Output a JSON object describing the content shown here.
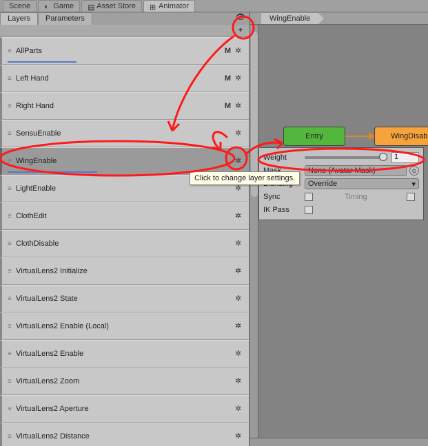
{
  "topTabs": [
    "Scene",
    "Game",
    "Asset Store",
    "Animator"
  ],
  "activeTopTab": "Animator",
  "subTabs": {
    "layers": "Layers",
    "parameters": "Parameters"
  },
  "breadcrumb": "WingEnable",
  "layers": [
    {
      "name": "AllParts",
      "m": true,
      "selected": false,
      "wbar": 100
    },
    {
      "name": "Left Hand",
      "m": true,
      "selected": false,
      "wbar": 0
    },
    {
      "name": "Right Hand",
      "m": true,
      "selected": false,
      "wbar": 0
    },
    {
      "name": "SensuEnable",
      "m": false,
      "selected": false,
      "wbar": 0
    },
    {
      "name": "WingEnable",
      "m": false,
      "selected": true,
      "wbar": 130
    },
    {
      "name": "LightEnable",
      "m": false,
      "selected": false,
      "wbar": 0
    },
    {
      "name": "ClothEdit",
      "m": false,
      "selected": false,
      "wbar": 0
    },
    {
      "name": "ClothDisable",
      "m": false,
      "selected": false,
      "wbar": 0
    },
    {
      "name": "VirtualLens2 Initialize",
      "m": false,
      "selected": false,
      "wbar": 0
    },
    {
      "name": "VirtualLens2 State",
      "m": false,
      "selected": false,
      "wbar": 0
    },
    {
      "name": "VirtualLens2 Enable (Local)",
      "m": false,
      "selected": false,
      "wbar": 0
    },
    {
      "name": "VirtualLens2 Enable",
      "m": false,
      "selected": false,
      "wbar": 0
    },
    {
      "name": "VirtualLens2 Zoom",
      "m": false,
      "selected": false,
      "wbar": 0
    },
    {
      "name": "VirtualLens2 Aperture",
      "m": false,
      "selected": false,
      "wbar": 0
    },
    {
      "name": "VirtualLens2 Distance",
      "m": false,
      "selected": false,
      "wbar": 0
    }
  ],
  "states": {
    "entry": "Entry",
    "wingDisable": "WingDisable"
  },
  "settings": {
    "weightLabel": "Weight",
    "weightValue": "1",
    "maskLabel": "Mask",
    "maskValue": "None (Avatar Mask)",
    "blendingLabel": "Blending",
    "blendingValue": "Override",
    "syncLabel": "Sync",
    "timingLabel": "Timing",
    "ikLabel": "IK Pass"
  },
  "tooltip": "Click to change layer settings.",
  "icons": {
    "gear": "✲",
    "m": "M",
    "plus": "+",
    "eye": "👁",
    "sel": "⊙",
    "drop": "▾",
    "drag": "≡"
  },
  "annotationColor": "#ff1a1a"
}
